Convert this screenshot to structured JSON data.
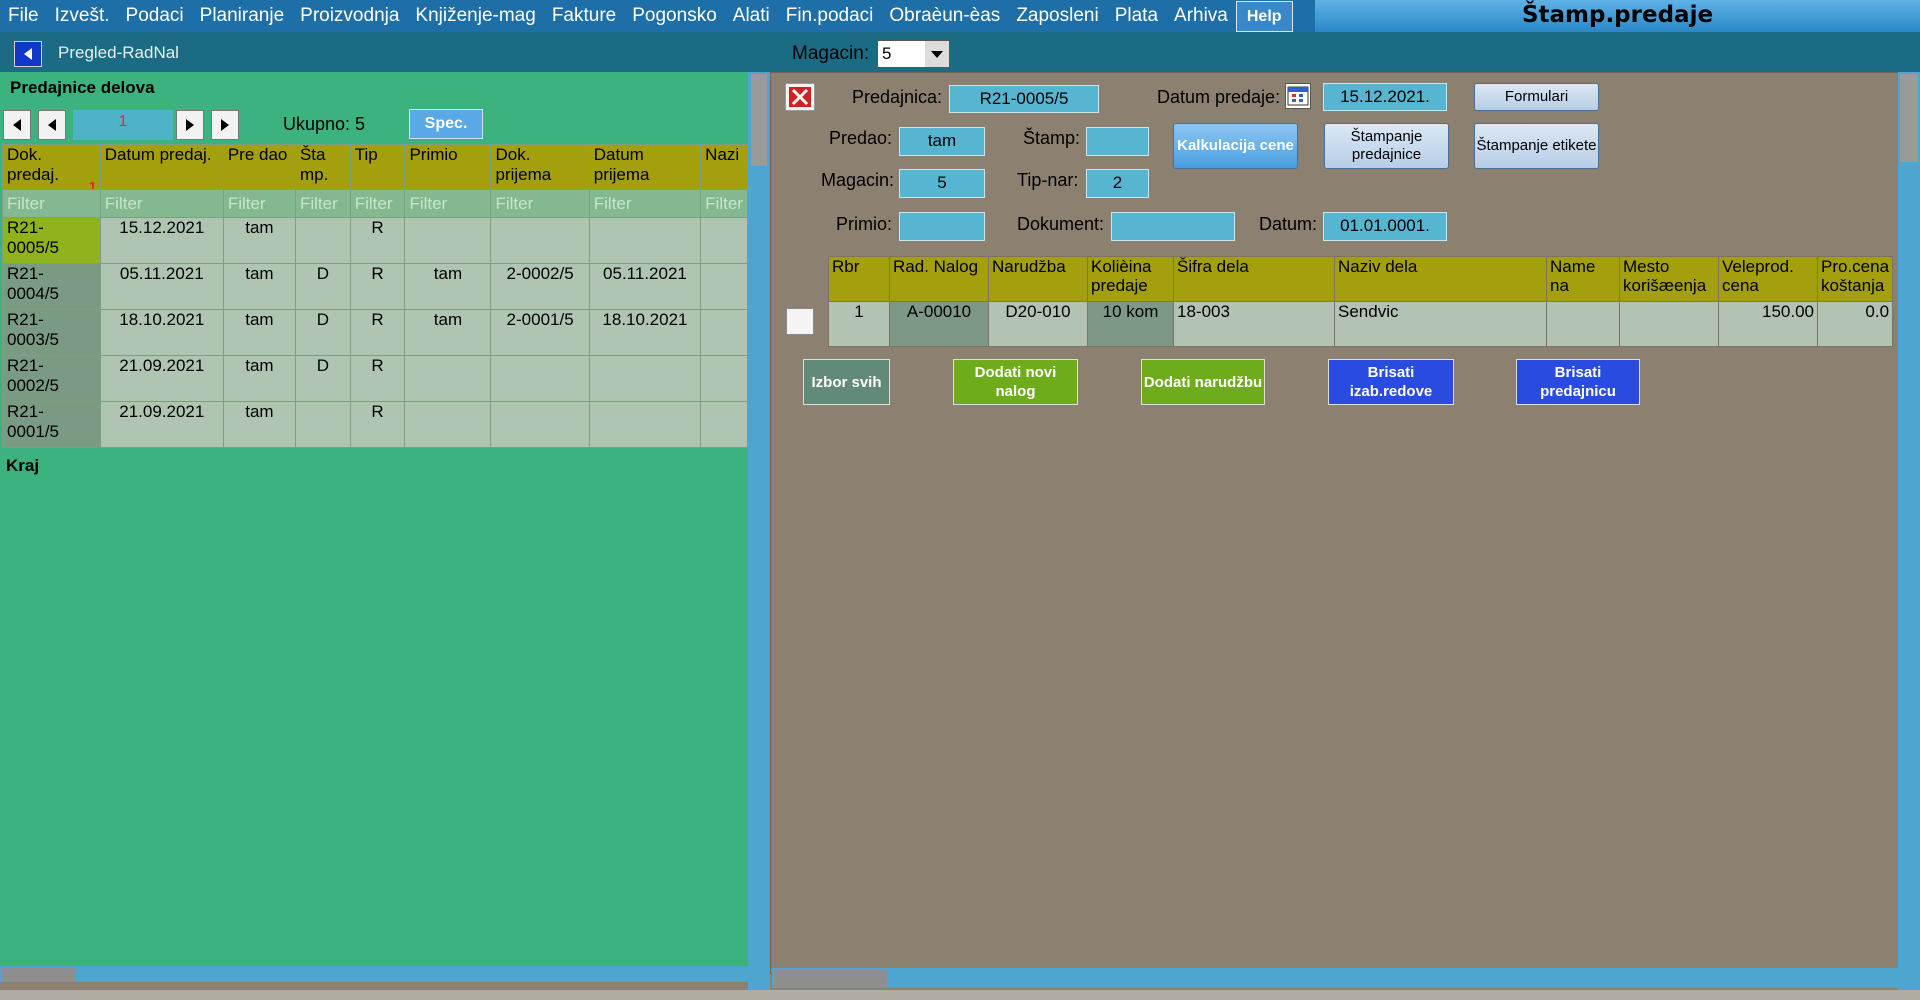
{
  "menu": {
    "items": [
      "File",
      "Izvešt.",
      "Podaci",
      "Planiranje",
      "Proizvodnja",
      "Knjiženje-mag",
      "Fakture",
      "Pogonsko",
      "Alati",
      "Fin.podaci",
      "Obraèun-èas",
      "Zaposleni",
      "Plata",
      "Arhiva"
    ],
    "help": "Help",
    "app_title": "Štamp.predaje"
  },
  "toolbar": {
    "view_title": "Pregled-RadNal",
    "magacin_label": "Magacin:",
    "magacin_value": "5"
  },
  "left": {
    "title": "Predajnice delova",
    "page": "1",
    "ukupno": "Ukupno: 5",
    "spec_label": "Spec.",
    "sort_marker": "1",
    "columns": [
      "Dok. predaj.",
      "Datum predaj.",
      "Pre dao",
      "Šta mp.",
      "Tip",
      "Primio",
      "Dok. prijema",
      "Datum prijema",
      "Nazi"
    ],
    "filter_placeholder": "Filter",
    "rows": [
      [
        "R21-0005/5",
        "15.12.2021",
        "tam",
        "",
        "R",
        "",
        "",
        "",
        ""
      ],
      [
        "R21-0004/5",
        "05.11.2021",
        "tam",
        "D",
        "R",
        "tam",
        "2-0002/5",
        "05.11.2021",
        ""
      ],
      [
        "R21-0003/5",
        "18.10.2021",
        "tam",
        "D",
        "R",
        "tam",
        "2-0001/5",
        "18.10.2021",
        ""
      ],
      [
        "R21-0002/5",
        "21.09.2021",
        "tam",
        "D",
        "R",
        "",
        "",
        "",
        ""
      ],
      [
        "R21-0001/5",
        "21.09.2021",
        "tam",
        "",
        "R",
        "",
        "",
        "",
        ""
      ]
    ],
    "end_label": "Kraj"
  },
  "form": {
    "predajnica_label": "Predajnica:",
    "predajnica": "R21-0005/5",
    "datum_predaje_label": "Datum predaje:",
    "datum_predaje": "15.12.2021.",
    "formulari": "Formulari",
    "predao_label": "Predao:",
    "predao": "tam",
    "stamp_label": "Štamp:",
    "stamp": "",
    "kalkulacija": "Kalkulacija cene",
    "stampanje_predajnice": "Štampanje predajnice",
    "stampanje_etikete": "Štampanje etikete",
    "magacin_label": "Magacin:",
    "magacin": "5",
    "tipnar_label": "Tip-nar:",
    "tipnar": "2",
    "primio_label": "Primio:",
    "primio": "",
    "dokument_label": "Dokument:",
    "dokument": "",
    "datum_label": "Datum:",
    "datum": "01.01.0001."
  },
  "items": {
    "columns": [
      "Rbr",
      "Rad. Nalog",
      "Narudžba",
      "Kolièina predaje",
      "Šifra dela",
      "Naziv dela",
      "Name na",
      "Mesto korišæenja",
      "Veleprod. cena",
      "Pro.cena koštanja"
    ],
    "rows": [
      [
        "1",
        "A-00010",
        "D20-010",
        "10 kom",
        "18-003",
        "Sendvic",
        "",
        "",
        "150.00",
        "0.0"
      ]
    ]
  },
  "actions": {
    "izbor_svih": "Izbor svih",
    "dodati_nalog": "Dodati novi nalog",
    "dodati_narudzbu": "Dodati narudžbu",
    "brisati_redove": "Brisati izab.redove",
    "brisati_predajnicu": "Brisati predajnicu"
  }
}
